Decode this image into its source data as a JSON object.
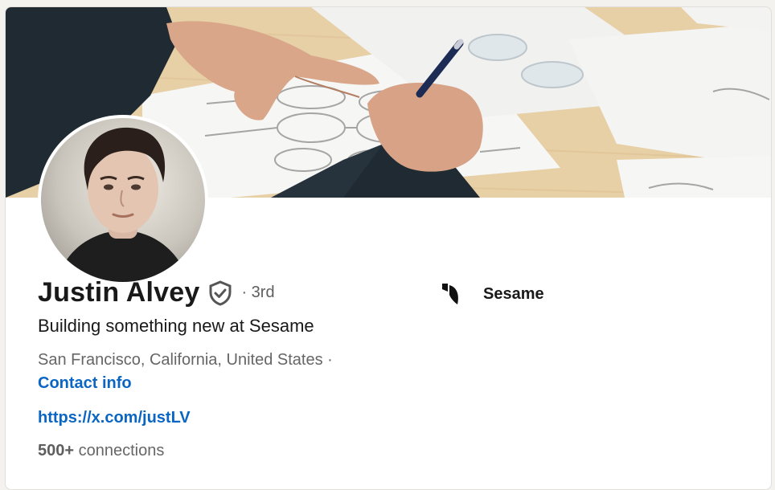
{
  "profile": {
    "name": "Justin Alvey",
    "degree": "· 3rd",
    "headline": "Building something new at Sesame",
    "location": "San Francisco, California, United States ·",
    "contact_label": "Contact info",
    "website": "https://x.com/justLV",
    "connections_count": "500+",
    "connections_label": "connections"
  },
  "company": {
    "name": "Sesame",
    "icon": "sesame-logo-icon"
  },
  "icons": {
    "verified": "verified-shield-icon"
  },
  "colors": {
    "link": "#0a66c2",
    "text_primary": "#191919",
    "text_secondary": "#666666",
    "page_background": "#f4f2ee"
  }
}
